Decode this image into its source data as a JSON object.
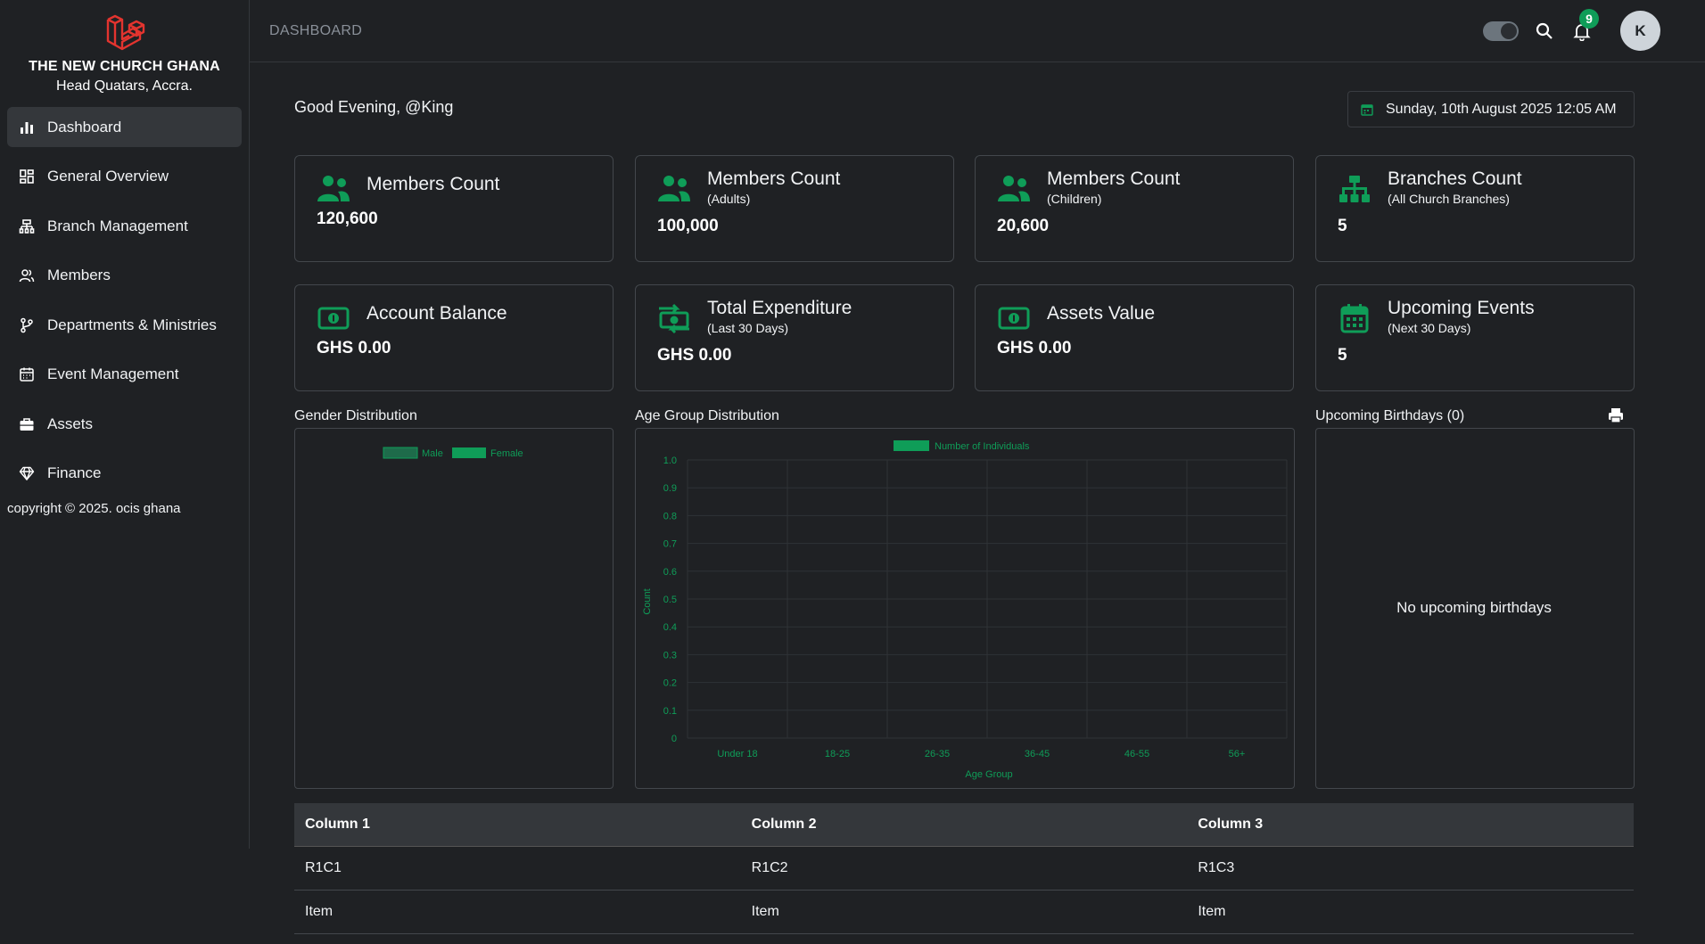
{
  "brand": {
    "name": "THE NEW CHURCH GHANA",
    "location": "Head Quatars, Accra."
  },
  "sidebar": {
    "items": [
      {
        "label": "Dashboard",
        "icon": "bar-chart-icon",
        "active": true
      },
      {
        "label": "General Overview",
        "icon": "grid-icon"
      },
      {
        "label": "Branch Management",
        "icon": "branch-icon"
      },
      {
        "label": "Members",
        "icon": "users-icon"
      },
      {
        "label": "Departments & Ministries",
        "icon": "git-branch-icon"
      },
      {
        "label": "Event Management",
        "icon": "calendar-icon"
      },
      {
        "label": "Assets",
        "icon": "briefcase-icon"
      },
      {
        "label": "Finance",
        "icon": "diamond-icon"
      }
    ],
    "copyright": "copyright © 2025. ocis ghana"
  },
  "topbar": {
    "title": "DASHBOARD",
    "notification_count": "9",
    "avatar_initial": "K"
  },
  "greeting": "Good Evening, @King",
  "date": "Sunday, 10th August 2025 12:05 AM",
  "cards": [
    {
      "title": "Members Count",
      "subtitle": "",
      "value": "120,600",
      "icon": "users-icon"
    },
    {
      "title": "Members Count",
      "subtitle": "(Adults)",
      "value": "100,000",
      "icon": "users-icon"
    },
    {
      "title": "Members Count",
      "subtitle": "(Children)",
      "value": "20,600",
      "icon": "users-icon"
    },
    {
      "title": "Branches Count",
      "subtitle": "(All Church Branches)",
      "value": "5",
      "icon": "sitemap-icon"
    },
    {
      "title": "Account Balance",
      "subtitle": "",
      "value": "GHS 0.00",
      "icon": "money-bill-icon"
    },
    {
      "title": "Total Expenditure",
      "subtitle": "(Last 30 Days)",
      "value": "GHS 0.00",
      "icon": "money-transfer-icon"
    },
    {
      "title": "Assets Value",
      "subtitle": "",
      "value": "GHS 0.00",
      "icon": "money-bill-icon"
    },
    {
      "title": "Upcoming Events",
      "subtitle": "(Next 30 Days)",
      "value": "5",
      "icon": "calendar-icon"
    }
  ],
  "sections": {
    "gender": "Gender Distribution",
    "age": "Age Group Distribution",
    "birthdays": "Upcoming Birthdays (0)",
    "no_birthdays": "No upcoming birthdays"
  },
  "chart_data": [
    {
      "type": "pie",
      "title": "",
      "legend": [
        "Male",
        "Female"
      ],
      "legend_colors": [
        "#1e6b4a",
        "#0f9d58"
      ],
      "values": [],
      "legend_position": "top"
    },
    {
      "type": "bar",
      "title": "",
      "categories": [
        "Under 18",
        "18-25",
        "26-35",
        "36-45",
        "46-55",
        "56+"
      ],
      "series": [
        {
          "name": "Number of Individuals",
          "values": [
            0,
            0,
            0,
            0,
            0,
            0
          ]
        }
      ],
      "xlabel": "Age Group",
      "ylabel": "Count",
      "ylim": [
        0,
        1.0
      ],
      "yticks": [
        "1.0",
        "0.9",
        "0.8",
        "0.7",
        "0.6",
        "0.5",
        "0.4",
        "0.3",
        "0.2",
        "0.1",
        "0"
      ],
      "grid": true,
      "legend_position": "top",
      "color": "#0f9d58"
    }
  ],
  "table": {
    "headers": [
      "Column 1",
      "Column 2",
      "Column 3"
    ],
    "rows": [
      [
        "R1C1",
        "R1C2",
        "R1C3"
      ],
      [
        "Item",
        "Item",
        "Item"
      ]
    ]
  },
  "colors": {
    "accent": "#0f9d58",
    "brand": "#e3342f",
    "background": "#1f2124"
  }
}
